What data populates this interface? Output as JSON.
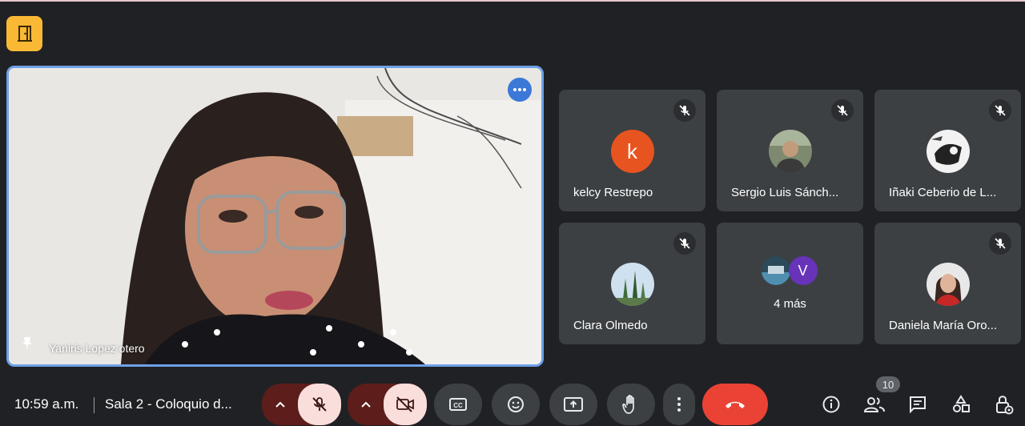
{
  "main_video": {
    "participant_name": "Yaniris Lopez otero",
    "icons": {
      "menu": "more-horizontal-icon",
      "pin": "pin-icon"
    }
  },
  "participants": [
    {
      "name": "kelcy Restrepo",
      "avatar_letter": "k",
      "avatar_color": "#e8541f",
      "muted": true
    },
    {
      "name": "Sergio Luis Sánch...",
      "muted": true
    },
    {
      "name": "Iñaki Ceberio de L...",
      "muted": true
    },
    {
      "name": "Clara Olmedo",
      "muted": true
    },
    {
      "name": "Daniela María Oro...",
      "muted": true
    }
  ],
  "more_participants": {
    "label": "4 más",
    "avatar_letter": "V",
    "avatar_color": "#6733b9"
  },
  "bottom_bar": {
    "time": "10:59 a.m.",
    "meeting_title": "Sala 2 - Coloquio d...",
    "people_count": "10",
    "icons": [
      "door-icon",
      "mic-off-icon",
      "camera-off-icon",
      "captions-icon",
      "emoji-icon",
      "present-icon",
      "raise-hand-icon",
      "more-vert-icon",
      "end-call-icon",
      "info-icon",
      "people-icon",
      "chat-icon",
      "activities-icon",
      "host-controls-icon"
    ]
  },
  "colors": {
    "background": "#202124",
    "tile": "#3c4043",
    "active_border": "#6fa0e8",
    "end_call": "#ea4335",
    "muted_button": "#f9dedc",
    "room_badge": "#f9b935"
  }
}
